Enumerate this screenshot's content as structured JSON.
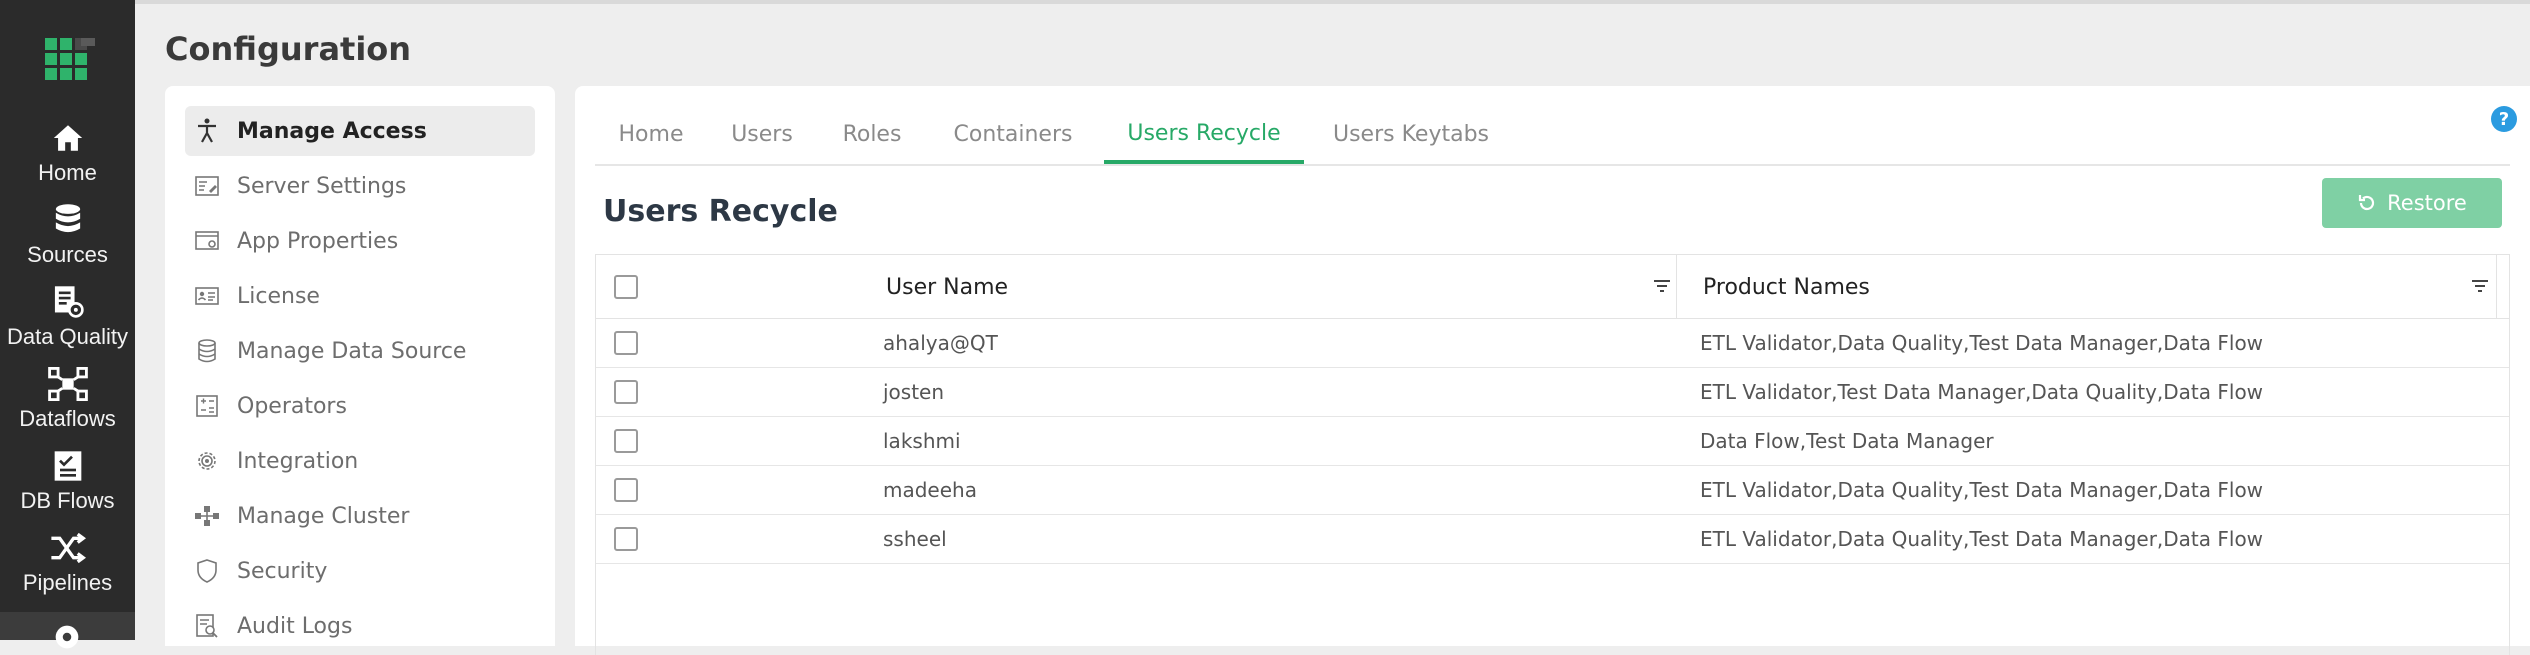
{
  "header": {
    "title": "Configuration"
  },
  "rail": {
    "items": [
      {
        "label": "Home",
        "icon": "home-icon"
      },
      {
        "label": "Sources",
        "icon": "database-icon"
      },
      {
        "label": "Data Quality",
        "icon": "data-quality-icon"
      },
      {
        "label": "Dataflows",
        "icon": "dataflows-icon"
      },
      {
        "label": "DB Flows",
        "icon": "db-flows-icon"
      },
      {
        "label": "Pipelines",
        "icon": "pipelines-icon"
      }
    ]
  },
  "menu": {
    "items": [
      {
        "label": "Manage Access",
        "icon": "accessibility-icon",
        "active": true
      },
      {
        "label": "Server Settings",
        "icon": "server-settings-icon"
      },
      {
        "label": "App Properties",
        "icon": "app-properties-icon"
      },
      {
        "label": "License",
        "icon": "license-icon"
      },
      {
        "label": "Manage Data Source",
        "icon": "database-icon"
      },
      {
        "label": "Operators",
        "icon": "operators-icon"
      },
      {
        "label": "Integration",
        "icon": "gear-icon"
      },
      {
        "label": "Manage Cluster",
        "icon": "cluster-icon"
      },
      {
        "label": "Security",
        "icon": "shield-icon"
      },
      {
        "label": "Audit Logs",
        "icon": "audit-logs-icon"
      }
    ]
  },
  "tabs": [
    {
      "label": "Home"
    },
    {
      "label": "Users"
    },
    {
      "label": "Roles"
    },
    {
      "label": "Containers"
    },
    {
      "label": "Users Recycle",
      "active": true
    },
    {
      "label": "Users Keytabs"
    }
  ],
  "help": {
    "label": "?"
  },
  "section": {
    "title": "Users Recycle"
  },
  "toolbar": {
    "restore_label": "Restore"
  },
  "table": {
    "columns": [
      "User Name",
      "Product Names"
    ],
    "rows": [
      {
        "user": "ahalya@QT",
        "products": "ETL Validator,Data Quality,Test Data Manager,Data Flow"
      },
      {
        "user": "josten",
        "products": "ETL Validator,Test Data Manager,Data Quality,Data Flow"
      },
      {
        "user": "lakshmi",
        "products": "Data Flow,Test Data Manager"
      },
      {
        "user": "madeeha",
        "products": "ETL Validator,Data Quality,Test Data Manager,Data Flow"
      },
      {
        "user": "ssheel",
        "products": "ETL Validator,Data Quality,Test Data Manager,Data Flow"
      }
    ]
  },
  "colors": {
    "accent": "#27a967",
    "restore_button": "#7fd0a4",
    "rail": "#2b2b2b",
    "help": "#2b9be0"
  }
}
